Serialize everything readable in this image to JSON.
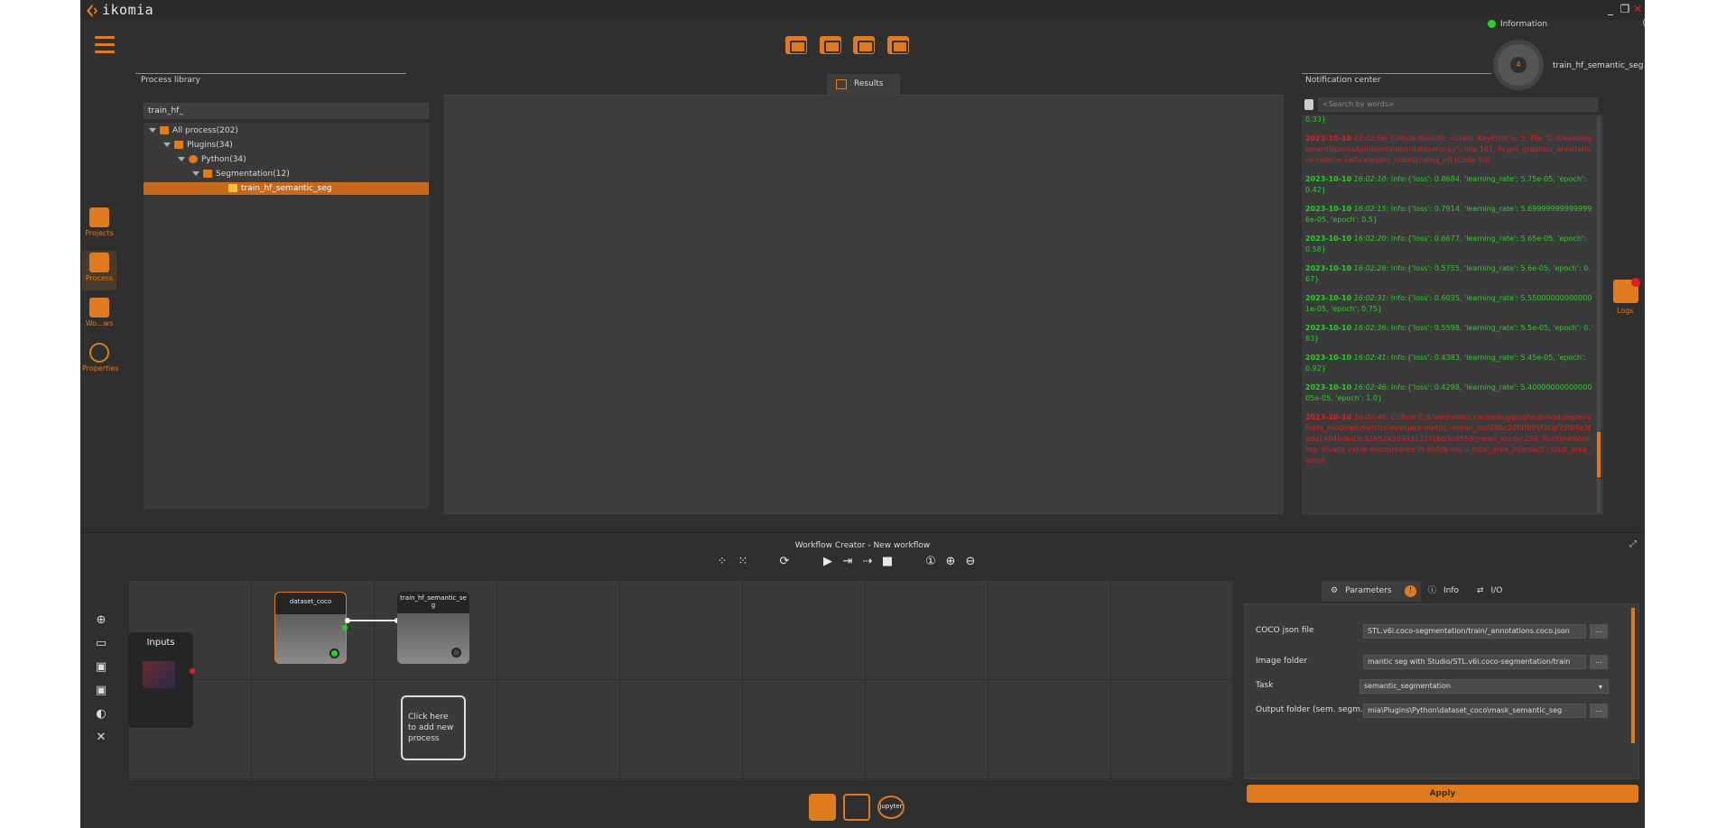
{
  "app": {
    "name": "ikomia",
    "window_controls": {
      "minimize": "_",
      "maximize": "❐",
      "close": "✕"
    }
  },
  "info_panel": {
    "title": "Information",
    "count": "4",
    "task_name": "train_hf_semantic_seg"
  },
  "process_library": {
    "title": "Process library",
    "search_value": "train_hf_",
    "tree": [
      {
        "label": "All process(202)",
        "level": 0
      },
      {
        "label": "Plugins(34)",
        "level": 1
      },
      {
        "label": "Python(34)",
        "level": 2
      },
      {
        "label": "Segmentation(12)",
        "level": 3
      },
      {
        "label": "train_hf_semantic_seg",
        "level": 4,
        "selected": true
      }
    ]
  },
  "results": {
    "tab_label": "Results"
  },
  "notification_center": {
    "title": "Notification center",
    "search_placeholder": "<Search by words>",
    "entries": [
      {
        "type": "top",
        "date": "",
        "time": "",
        "text": "0.33}"
      },
      {
        "type": "crit",
        "date": "2023-10-10",
        "time": "16:02:06",
        "text": ": Critical:Results: <class 'KeyError'>: 5. File \"C:\\Developpement\\IkomiaApi\\ikomia\\dnn\\datasetio.py\", line 161, in get_graphics_annotations color = self.category_colors[categ_id] (Code 10)"
      },
      {
        "type": "info",
        "date": "2023-10-10",
        "time": "16:02:10",
        "text": ": Info:{'loss': 0.8684, 'learning_rate': 5.75e-05, 'epoch': 0.42}"
      },
      {
        "type": "info",
        "date": "2023-10-10",
        "time": "16:02:15",
        "text": ": Info:{'loss': 0.7914, 'learning_rate': 5.699999999999996e-05, 'epoch': 0.5}"
      },
      {
        "type": "info",
        "date": "2023-10-10",
        "time": "16:02:20",
        "text": ": Info:{'loss': 0.6677, 'learning_rate': 5.65e-05, 'epoch': 0.58}"
      },
      {
        "type": "info",
        "date": "2023-10-10",
        "time": "16:02:26",
        "text": ": Info:{'loss': 0.5755, 'learning_rate': 5.6e-05, 'epoch': 0.67}"
      },
      {
        "type": "info",
        "date": "2023-10-10",
        "time": "16:02:31",
        "text": ": Info:{'loss': 0.6035, 'learning_rate': 5.550000000000001e-05, 'epoch': 0.75}"
      },
      {
        "type": "info",
        "date": "2023-10-10",
        "time": "16:02:36",
        "text": ": Info:{'loss': 0.5598, 'learning_rate': 5.5e-05, 'epoch': 0.83}"
      },
      {
        "type": "info",
        "date": "2023-10-10",
        "time": "16:02:41",
        "text": ": Info:{'loss': 0.4383, 'learning_rate': 5.45e-05, 'epoch': 0.92}"
      },
      {
        "type": "info",
        "date": "2023-10-10",
        "time": "16:02:46",
        "text": ": Info:{'loss': 0.4298, 'learning_rate': 5.4000000000000005e-05, 'epoch': 1.0}"
      },
      {
        "type": "crit",
        "date": "2023-10-10",
        "time": "16:02:46",
        "text": ": Critical:C:\\Users\\allan\\.cache\\huggingface\\modules\\evaluate_modules\\metrics\\evaluate-metric--mean_iou\\08bc20f4f895f3caf75fb9e3fada1404bded3c3265243d3931327cbb3b9559\\mean_iou.py:259: RuntimeWarning: invalid value encountered in divide iou = total_area_intersect / total_area_union"
      }
    ]
  },
  "sidebar": {
    "items": [
      {
        "label": "Projects"
      },
      {
        "label": "Process"
      },
      {
        "label": "Wo...ws"
      },
      {
        "label": "Properties"
      }
    ]
  },
  "logs_button": {
    "label": "Logs"
  },
  "workflow": {
    "title": "Workflow Creator - New workflow",
    "inputs_label": "Inputs",
    "nodes": [
      {
        "label": "dataset_coco"
      },
      {
        "label": "train_hf_semantic_seg"
      }
    ],
    "add_process_hint": "Click here to add new process"
  },
  "parameters": {
    "tabs": [
      {
        "label": "Parameters"
      },
      {
        "label": "Info"
      },
      {
        "label": "I/O"
      }
    ],
    "rows": [
      {
        "label": "COCO json file",
        "value": "STL.v6i.coco-segmentation/train/_annotations.coco.json",
        "button": "..."
      },
      {
        "label": "Image folder",
        "value": "mantic seg with Studio/STL.v6i.coco-segmentation/train",
        "button": "..."
      },
      {
        "label": "Task",
        "value": "semantic_segmentation",
        "button": ""
      },
      {
        "label": "Output folder (sem. segm.)",
        "value": "mia\\Plugins\\Python\\dataset_coco\\mask_semantic_seg",
        "button": "..."
      }
    ],
    "apply_label": "Apply"
  },
  "bottom_bar": {
    "jupyter_label": "jupyter"
  }
}
